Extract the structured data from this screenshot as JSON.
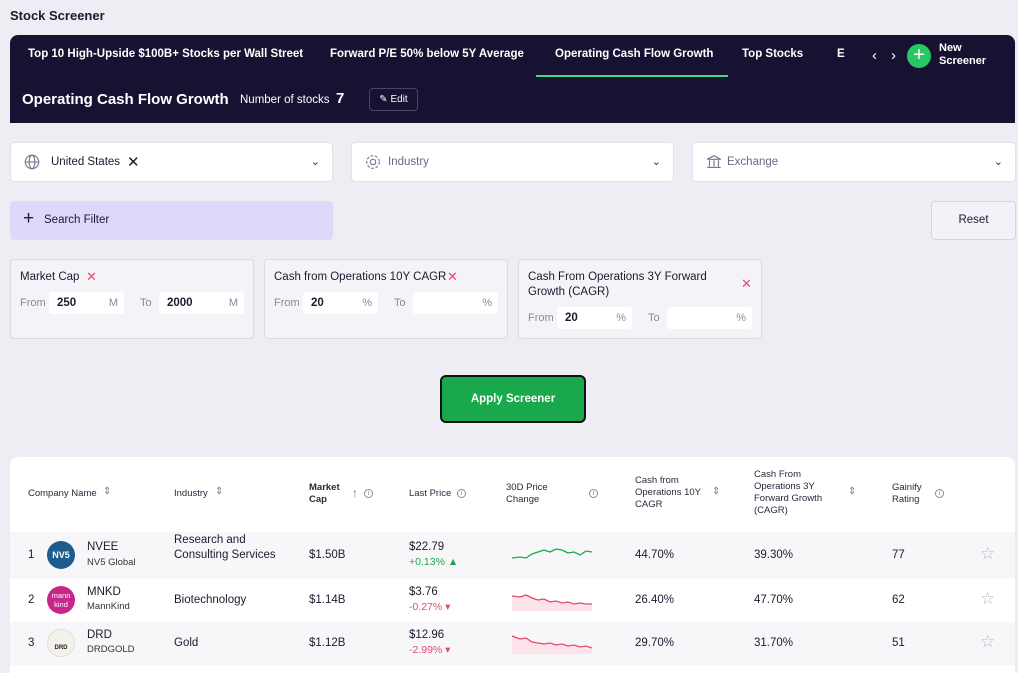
{
  "page_title": "Stock Screener",
  "tabs": [
    {
      "label": "Top 10 High-Upside $100B+ Stocks per Wall Street"
    },
    {
      "label": "Forward P/E 50% below 5Y Average"
    },
    {
      "label": "Operating Cash Flow Growth"
    },
    {
      "label": "Top Stocks"
    },
    {
      "label": "Exam"
    }
  ],
  "new_screener_label": "New Screener",
  "screener": {
    "title": "Operating Cash Flow Growth",
    "num_stocks_label": "Number of stocks",
    "num_stocks": "7",
    "edit_label": "Edit"
  },
  "dropdowns": {
    "country": "United States",
    "industry_placeholder": "Industry",
    "exchange_placeholder": "Exchange"
  },
  "search_filter_label": "Search Filter",
  "reset_label": "Reset",
  "filters": [
    {
      "title": "Market Cap",
      "from_label": "From",
      "from": "250",
      "from_unit": "M",
      "to_label": "To",
      "to": "2000",
      "to_unit": "M"
    },
    {
      "title": "Cash from Operations 10Y CAGR",
      "from_label": "From",
      "from": "20",
      "from_unit": "%",
      "to_label": "To",
      "to": "",
      "to_unit": "%"
    },
    {
      "title": "Cash From Operations 3Y Forward Growth (CAGR)",
      "from_label": "From",
      "from": "20",
      "from_unit": "%",
      "to_label": "To",
      "to": "",
      "to_unit": "%"
    }
  ],
  "apply_label": "Apply Screener",
  "table": {
    "headers": {
      "company": "Company Name",
      "industry": "Industry",
      "market_cap": "Market Cap",
      "last_price": "Last Price",
      "price_change": "30D Price Change",
      "cfo_10y": "Cash from Operations 10Y CAGR",
      "cfo_3y": "Cash From Operations 3Y Forward Growth (CAGR)",
      "rating": "Gainify Rating"
    },
    "rows": [
      {
        "rank": "1",
        "logo": "NV5",
        "ticker": "NVEE",
        "name": "NV5 Global",
        "industry": "Research and Consulting Services",
        "market_cap": "$1.50B",
        "price": "$22.79",
        "change": "+0.13% ▲",
        "cfo_10y": "44.70%",
        "cfo_3y": "39.30%",
        "rating": "77"
      },
      {
        "rank": "2",
        "logo": "mann kind",
        "ticker": "MNKD",
        "name": "MannKind",
        "industry": "Biotechnology",
        "market_cap": "$1.14B",
        "price": "$3.76",
        "change": "-0.27% ▾",
        "cfo_10y": "26.40%",
        "cfo_3y": "47.70%",
        "rating": "62"
      },
      {
        "rank": "3",
        "logo": "DRD",
        "ticker": "DRD",
        "name": "DRDGOLD",
        "industry": "Gold",
        "market_cap": "$1.12B",
        "price": "$12.96",
        "change": "-2.99% ▾",
        "cfo_10y": "29.70%",
        "cfo_3y": "31.70%",
        "rating": "51"
      }
    ]
  },
  "colors": {
    "header_bg": "#181232",
    "accent_green": "#27c864",
    "up": "#1aa84c",
    "down": "#e8476a",
    "search_filter_bg": "#dcd9fa"
  }
}
